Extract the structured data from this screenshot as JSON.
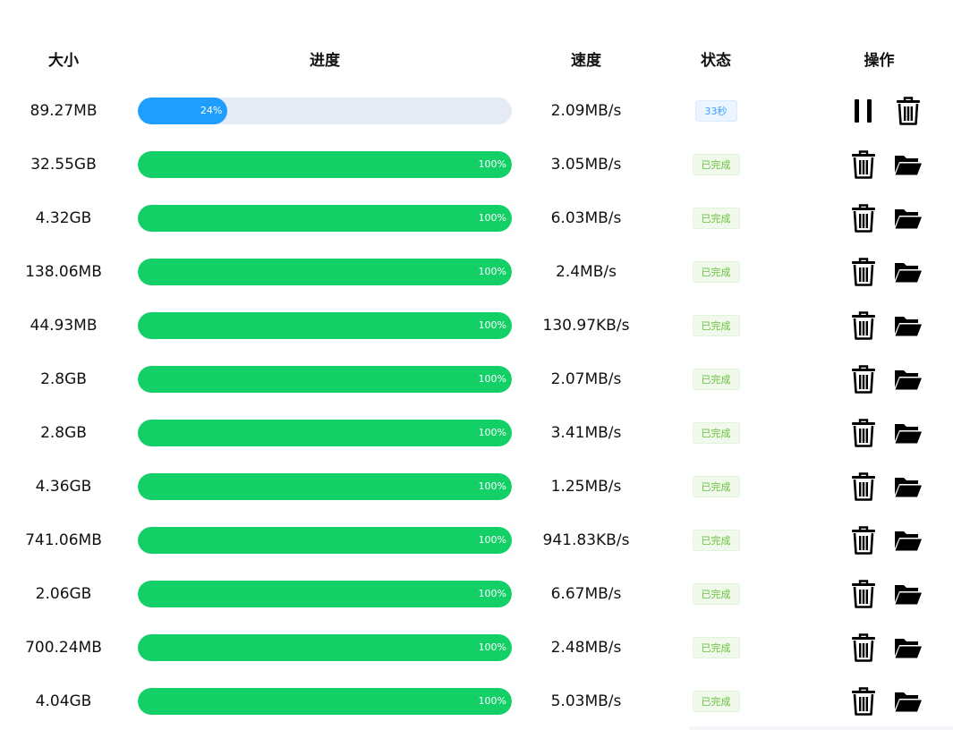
{
  "columns": {
    "size": "大小",
    "progress": "进度",
    "speed": "速度",
    "status": "状态",
    "actions": "操作"
  },
  "colors": {
    "progress_active": "#1e9fff",
    "progress_done": "#12cf66",
    "progress_track": "#e5eaf4",
    "status_done_text": "#67c23a",
    "status_time_text": "#409eff"
  },
  "rows": [
    {
      "size": "89.27MB",
      "progress": 24,
      "progress_label": "24%",
      "speed": "2.09MB/s",
      "status": "33秒",
      "state": "downloading",
      "actions": [
        "pause-icon",
        "trash-icon"
      ]
    },
    {
      "size": "32.55GB",
      "progress": 100,
      "progress_label": "100%",
      "speed": "3.05MB/s",
      "status": "已完成",
      "state": "done",
      "actions": [
        "trash-icon",
        "folder-open-icon"
      ]
    },
    {
      "size": "4.32GB",
      "progress": 100,
      "progress_label": "100%",
      "speed": "6.03MB/s",
      "status": "已完成",
      "state": "done",
      "actions": [
        "trash-icon",
        "folder-open-icon"
      ]
    },
    {
      "size": "138.06MB",
      "progress": 100,
      "progress_label": "100%",
      "speed": "2.4MB/s",
      "status": "已完成",
      "state": "done",
      "actions": [
        "trash-icon",
        "folder-open-icon"
      ]
    },
    {
      "size": "44.93MB",
      "progress": 100,
      "progress_label": "100%",
      "speed": "130.97KB/s",
      "status": "已完成",
      "state": "done",
      "actions": [
        "trash-icon",
        "folder-open-icon"
      ]
    },
    {
      "size": "2.8GB",
      "progress": 100,
      "progress_label": "100%",
      "speed": "2.07MB/s",
      "status": "已完成",
      "state": "done",
      "actions": [
        "trash-icon",
        "folder-open-icon"
      ]
    },
    {
      "size": "2.8GB",
      "progress": 100,
      "progress_label": "100%",
      "speed": "3.41MB/s",
      "status": "已完成",
      "state": "done",
      "actions": [
        "trash-icon",
        "folder-open-icon"
      ]
    },
    {
      "size": "4.36GB",
      "progress": 100,
      "progress_label": "100%",
      "speed": "1.25MB/s",
      "status": "已完成",
      "state": "done",
      "actions": [
        "trash-icon",
        "folder-open-icon"
      ]
    },
    {
      "size": "741.06MB",
      "progress": 100,
      "progress_label": "100%",
      "speed": "941.83KB/s",
      "status": "已完成",
      "state": "done",
      "actions": [
        "trash-icon",
        "folder-open-icon"
      ]
    },
    {
      "size": "2.06GB",
      "progress": 100,
      "progress_label": "100%",
      "speed": "6.67MB/s",
      "status": "已完成",
      "state": "done",
      "actions": [
        "trash-icon",
        "folder-open-icon"
      ]
    },
    {
      "size": "700.24MB",
      "progress": 100,
      "progress_label": "100%",
      "speed": "2.48MB/s",
      "status": "已完成",
      "state": "done",
      "actions": [
        "trash-icon",
        "folder-open-icon"
      ]
    },
    {
      "size": "4.04GB",
      "progress": 100,
      "progress_label": "100%",
      "speed": "5.03MB/s",
      "status": "已完成",
      "state": "done",
      "actions": [
        "trash-icon",
        "folder-open-icon"
      ]
    }
  ]
}
